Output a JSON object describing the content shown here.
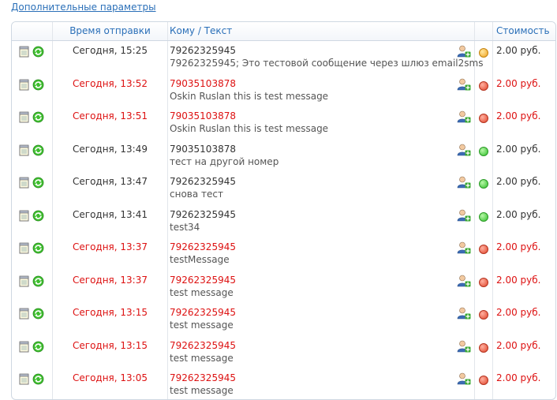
{
  "top_link": "Дополнительные параметры",
  "headers": {
    "time": "Время отправки",
    "to_text": "Кому / Текст",
    "cost": "Стоимость"
  },
  "rows": [
    {
      "time": "Сегодня, 15:25",
      "phone": "79262325945",
      "message": "79262325945; Это тестовой сообщение через шлюз email2sms",
      "cost": "2.00 руб.",
      "status": "orange"
    },
    {
      "time": "Сегодня, 13:52",
      "phone": "79035103878",
      "message": "Oskin Ruslan this is test message",
      "cost": "2.00 руб.",
      "status": "red"
    },
    {
      "time": "Сегодня, 13:51",
      "phone": "79035103878",
      "message": "Oskin Ruslan this is test message",
      "cost": "2.00 руб.",
      "status": "red"
    },
    {
      "time": "Сегодня, 13:49",
      "phone": "79035103878",
      "message": "тест на другой номер",
      "cost": "2.00 руб.",
      "status": "green"
    },
    {
      "time": "Сегодня, 13:47",
      "phone": "79262325945",
      "message": "снова тест",
      "cost": "2.00 руб.",
      "status": "green"
    },
    {
      "time": "Сегодня, 13:41",
      "phone": "79262325945",
      "message": "test34",
      "cost": "2.00 руб.",
      "status": "green"
    },
    {
      "time": "Сегодня, 13:37",
      "phone": "79262325945",
      "message": "testMessage",
      "cost": "2.00 руб.",
      "status": "red"
    },
    {
      "time": "Сегодня, 13:37",
      "phone": "79262325945",
      "message": "test message",
      "cost": "2.00 руб.",
      "status": "red"
    },
    {
      "time": "Сегодня, 13:15",
      "phone": "79262325945",
      "message": "test message",
      "cost": "2.00 руб.",
      "status": "red"
    },
    {
      "time": "Сегодня, 13:15",
      "phone": "79262325945",
      "message": "test message",
      "cost": "2.00 руб.",
      "status": "red"
    },
    {
      "time": "Сегодня, 13:05",
      "phone": "79262325945",
      "message": "test message",
      "cost": "2.00 руб.",
      "status": "red"
    }
  ]
}
